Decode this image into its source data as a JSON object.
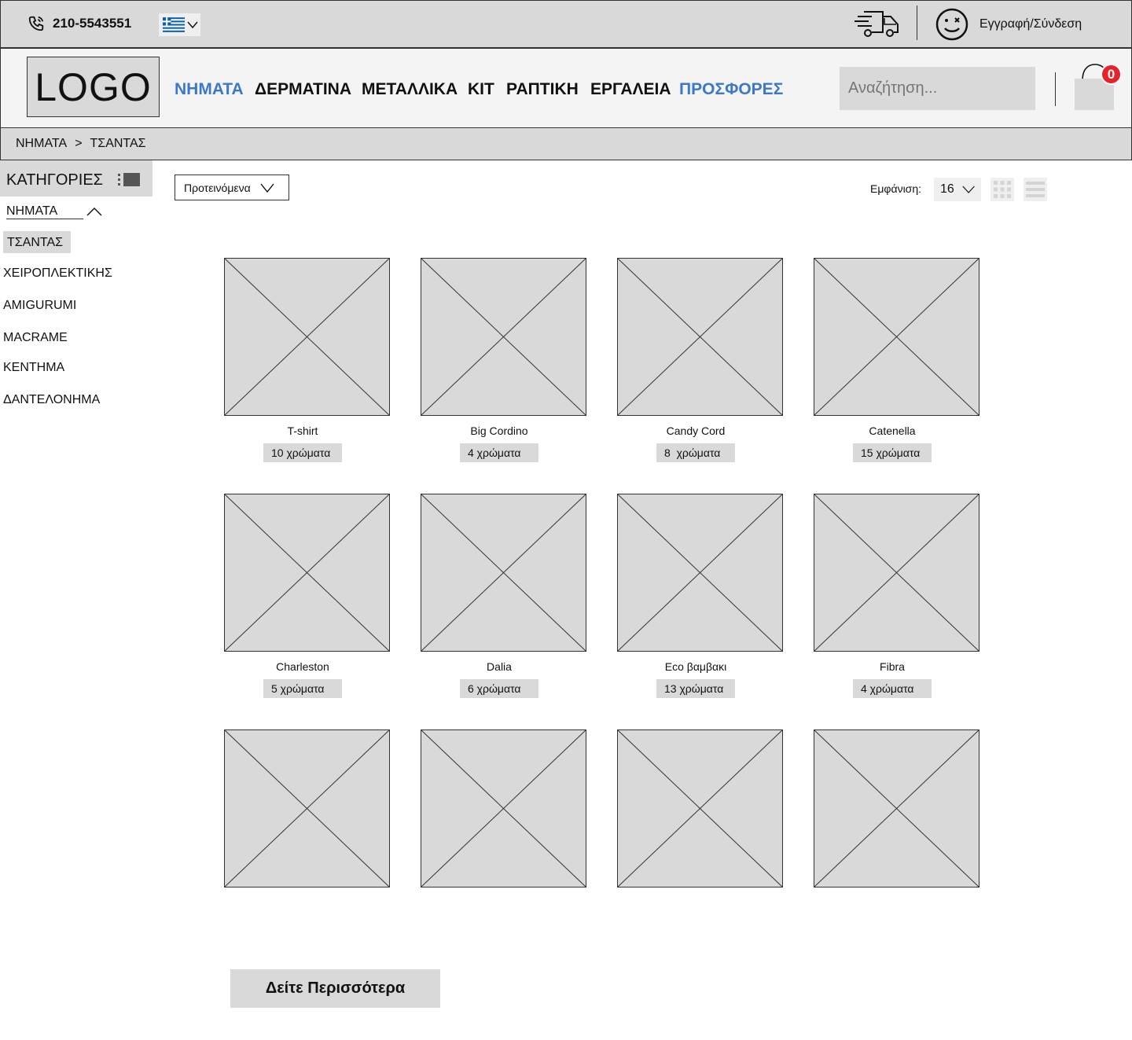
{
  "topbar": {
    "phone": "210-5543551",
    "login_label": "Εγγραφή/Σύνδεση",
    "icons": [
      "phone-icon",
      "greek-flag-icon",
      "delivery-truck-icon",
      "smiley-user-icon"
    ]
  },
  "header": {
    "logo": "LOGO",
    "nav": [
      "ΝΗΜΑΤΑ",
      "ΔΕΡΜΑΤΙΝΑ",
      "ΜΕΤΑΛΛΙΚΑ",
      "ΚΙΤ",
      "ΡΑΠΤΙΚΗ",
      "ΕΡΓΑΛΕΙΑ",
      "ΠΡΟΣΦΟΡΕΣ"
    ],
    "search_placeholder": "Αναζήτηση...",
    "cart_count": "0",
    "accent_color": "#3c78c8",
    "badge_color": "#e8222a"
  },
  "breadcrumb": {
    "items": [
      "ΝΗΜΑΤΑ",
      ">",
      "ΤΣΑΝΤΑΣ"
    ]
  },
  "sidebar": {
    "title": "ΚΑΤΗΓΟΡΙΕΣ",
    "parent": "ΝΗΜΑΤΑ",
    "items": [
      "ΤΣΑΝΤΑΣ",
      "ΧΕΙΡΟΠΛΕΚΤΙΚΗΣ",
      "AMIGURUMI",
      "MACRAME",
      "ΚΕΝΤΗΜΑ",
      "ΔΑΝΤΕΛΟΝΗΜΑ"
    ],
    "active": "ΤΣΑΝΤΑΣ"
  },
  "toolbar": {
    "sort_value": "Προτεινόμενα",
    "show_label": "Εμφάνιση:",
    "per_page": "16"
  },
  "products": [
    {
      "name": "T-shirt",
      "colors": "10 χρώματα"
    },
    {
      "name": "Big Cordino",
      "colors": "4 χρώματα"
    },
    {
      "name": "Candy Cord",
      "colors": "8  χρώματα"
    },
    {
      "name": "Catenella",
      "colors": "15 χρώματα"
    },
    {
      "name": "Charleston",
      "colors": "5 χρώματα"
    },
    {
      "name": "Dalia",
      "colors": "6 χρώματα"
    },
    {
      "name": "Eco βαμβακι",
      "colors": "13 χρώματα"
    },
    {
      "name": "Fibra",
      "colors": "4 χρώματα"
    },
    {
      "name": "",
      "colors": ""
    },
    {
      "name": "",
      "colors": ""
    },
    {
      "name": "",
      "colors": ""
    },
    {
      "name": "",
      "colors": ""
    }
  ],
  "load_more_label": "Δείτε Περισσότερα"
}
